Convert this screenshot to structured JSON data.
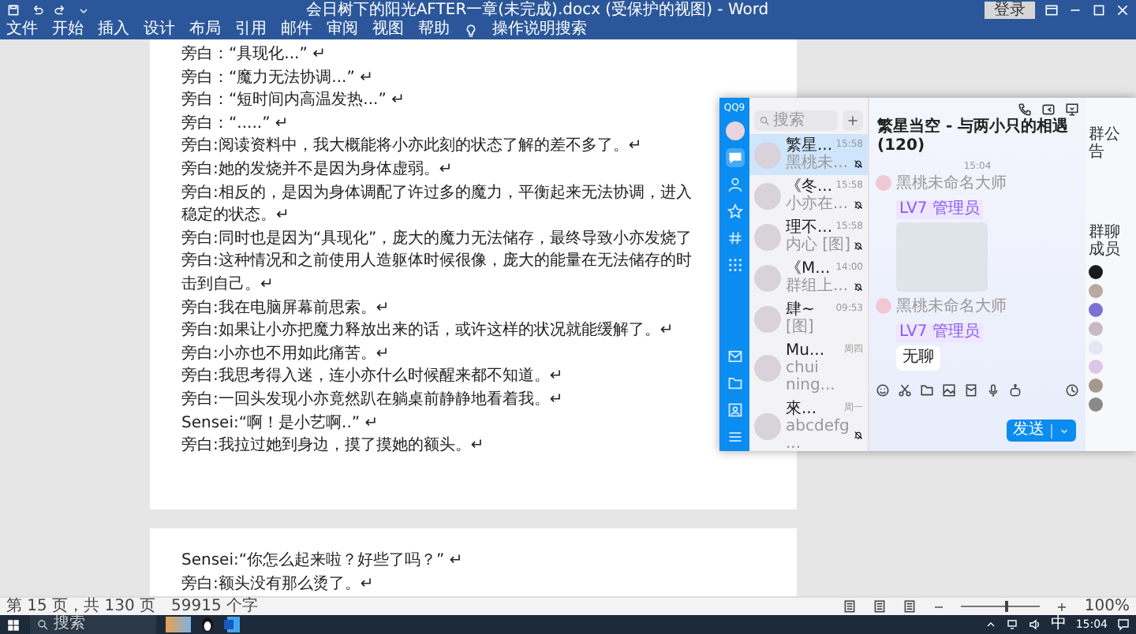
{
  "word": {
    "title": "会日树下的阳光AFTER一章(未完成).docx (受保护的视图) - Word",
    "sign_in": "登录",
    "ribbon_tabs": [
      "文件",
      "开始",
      "插入",
      "设计",
      "布局",
      "引用",
      "邮件",
      "审阅",
      "视图",
      "帮助"
    ],
    "tell_me": "操作说明搜索",
    "pages": [
      {
        "lines": [
          "旁白：“具现化...” ↵",
          "旁白：“魔力无法协调...” ↵",
          "旁白：“短时间内高温发热...” ↵",
          "旁白：“.....” ↵",
          "旁白:阅读资料中，我大概能将小亦此刻的状态了解的差不多了。↵",
          "旁白:她的发烧并不是因为身体虚弱。↵",
          "旁白:相反的，是因为身体调配了许过多的魔力，平衡起来无法协调，进入",
          "稳定的状态。↵",
          "旁白:同时也是因为“具现化”，庞大的魔力无法储存，最终导致小亦发烧了",
          "旁白:这种情况和之前使用人造躯体时候很像，庞大的能量在无法储存的时",
          "击到自己。↵",
          "旁白:我在电脑屏幕前思索。↵",
          "旁白:如果让小亦把魔力释放出来的话，或许这样的状况就能缓解了。↵",
          "旁白:小亦也不用如此痛苦。↵",
          "旁白:我思考得入迷，连小亦什么时候醒来都不知道。↵",
          "旁白:一回头发现小亦竟然趴在躺桌前静静地看着我。↵",
          "Sensei:“啊！是小艺啊..” ↵",
          "旁白:我拉过她到身边，摸了摸她的额头。↵"
        ]
      },
      {
        "lines": [
          "Sensei:“你怎么起来啦？好些了吗？” ↵",
          "旁白:额头没有那么烫了。↵"
        ]
      }
    ],
    "status_bar": {
      "page": "第 15 页，共 130 页",
      "words": "59915 个字",
      "zoom": "100%",
      "zoom_slider": {
        "level": 0.55
      }
    }
  },
  "qq": {
    "logo": "QQ9",
    "nav": [
      {
        "kind": "chat",
        "selected": true
      },
      {
        "kind": "person",
        "selected": false
      },
      {
        "kind": "star",
        "selected": false
      },
      {
        "kind": "hash",
        "selected": false
      },
      {
        "kind": "grid",
        "selected": false
      }
    ],
    "nav_bottom": [
      {
        "kind": "mail",
        "selected": false
      },
      {
        "kind": "folder",
        "selected": false
      },
      {
        "kind": "photo",
        "selected": false
      },
      {
        "kind": "menu",
        "selected": false
      }
    ],
    "search": {
      "placeholder": "搜索"
    },
    "contacts": [
      {
        "name": "繁星...",
        "time": "15:58",
        "preview": "黑桃未...",
        "selected": true,
        "muted": true
      },
      {
        "name": "《冬...",
        "time": "15:58",
        "preview": "小亦在...",
        "selected": false,
        "muted": true
      },
      {
        "name": "理不...",
        "time": "15:58",
        "preview": "内心 [图]",
        "selected": false,
        "muted": true
      },
      {
        "name": "《M...",
        "time": "14:00",
        "preview": "群组上...",
        "selected": false,
        "muted": true
      },
      {
        "name": "肆~",
        "time": "09:53",
        "preview": "[图]",
        "selected": false,
        "muted": false
      },
      {
        "name": "Mu...",
        "time": "周四",
        "preview": "chui ning...",
        "selected": false,
        "muted": false
      },
      {
        "name": "來...",
        "time": "周一",
        "preview": "abcdefg...",
        "selected": false,
        "muted": true
      }
    ],
    "chat": {
      "title": "繁星当空 - 与两小只的相遇 (120)",
      "time": "15:04",
      "messages": [
        {
          "kind": "sticker",
          "sender": "黑桃未命名大师",
          "tag": "LV7 管理员"
        },
        {
          "kind": "text",
          "sender": "黑桃未命名大师",
          "tag": "LV7 管理员",
          "text": "无聊"
        }
      ],
      "send": "发送"
    },
    "panel": {
      "announcement_title": "群公告",
      "members_title": "群聊成员"
    }
  },
  "taskbar": {
    "search": {
      "placeholder": "搜索"
    },
    "ime": "中",
    "time": "15:04"
  }
}
